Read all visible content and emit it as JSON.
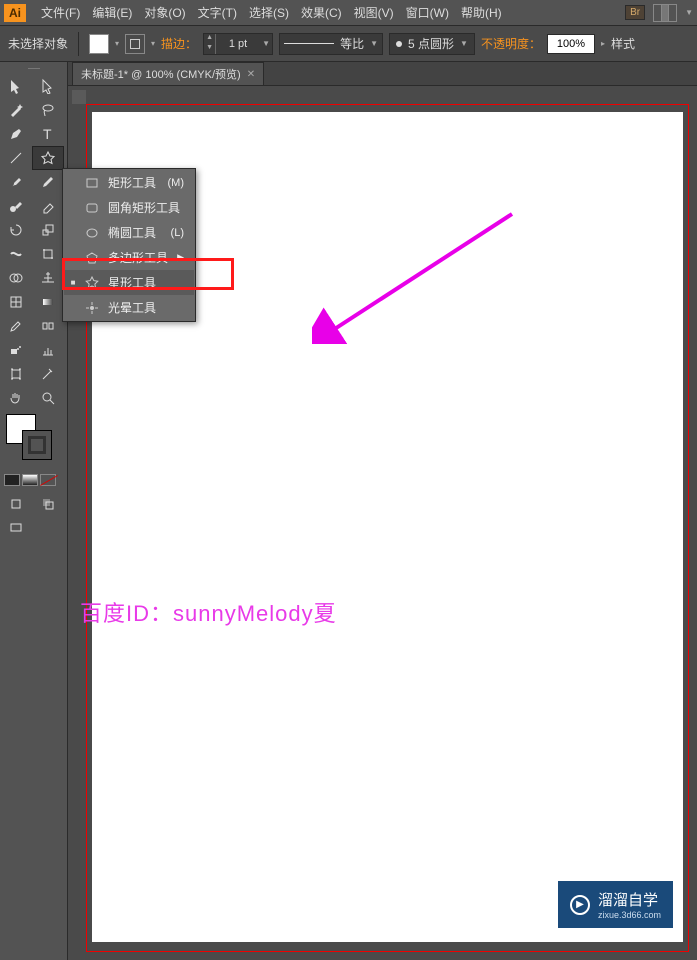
{
  "app": {
    "logo": "Ai"
  },
  "menu": [
    {
      "label": "文件(F)"
    },
    {
      "label": "编辑(E)"
    },
    {
      "label": "对象(O)"
    },
    {
      "label": "文字(T)"
    },
    {
      "label": "选择(S)"
    },
    {
      "label": "效果(C)"
    },
    {
      "label": "视图(V)"
    },
    {
      "label": "窗口(W)"
    },
    {
      "label": "帮助(H)"
    }
  ],
  "topbar_right": {
    "br": "Br"
  },
  "control": {
    "status": "未选择对象",
    "stroke_label": "描边：",
    "stroke_value": "1 pt",
    "uniform": "等比",
    "profile": "5 点圆形",
    "opacity_label": "不透明度：",
    "opacity_value": "100%",
    "style_label": "样式"
  },
  "tab": {
    "title": "未标题-1* @ 100% (CMYK/预览)"
  },
  "flyout": [
    {
      "label": "矩形工具",
      "shortcut": "(M)"
    },
    {
      "label": "圆角矩形工具",
      "shortcut": ""
    },
    {
      "label": "椭圆工具",
      "shortcut": "(L)"
    },
    {
      "label": "多边形工具",
      "shortcut": "",
      "submenu": true
    },
    {
      "label": "星形工具",
      "shortcut": "",
      "active": true
    },
    {
      "label": "光晕工具",
      "shortcut": ""
    }
  ],
  "watermark": "百度ID：sunnyMelody夏",
  "brand": {
    "text": "溜溜自学",
    "url": "zixue.3d66.com"
  },
  "colors": {
    "accent": "#f7931e",
    "highlight": "#ff1a1a",
    "arrow": "#e800e8"
  }
}
